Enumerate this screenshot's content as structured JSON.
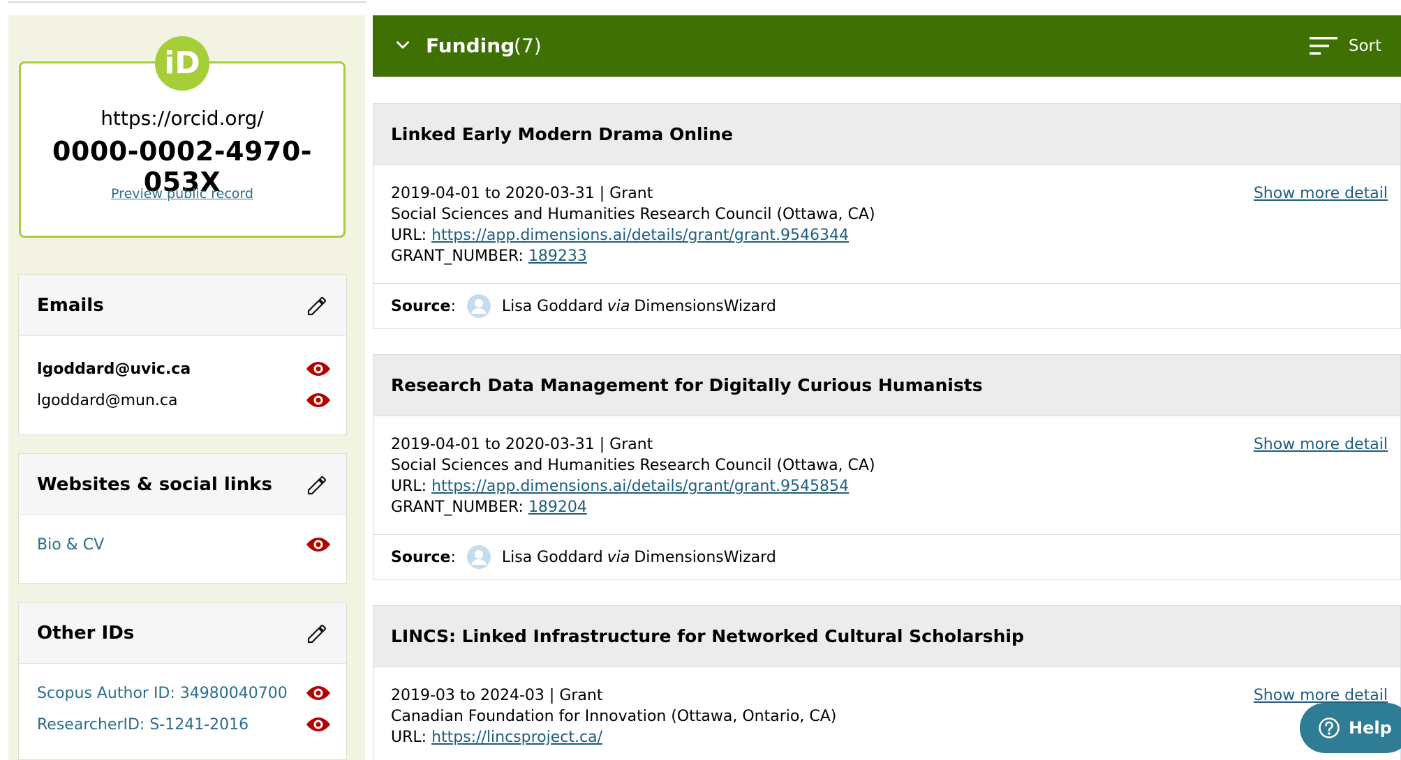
{
  "orcid": {
    "prefix": "https://orcid.org/",
    "id": "0000-0002-4970-053X",
    "preview_link": "Preview public record",
    "logo_text": "iD"
  },
  "emails": {
    "title": "Emails",
    "items": [
      "lgoddard@uvic.ca",
      "lgoddard@mun.ca"
    ]
  },
  "websites": {
    "title": "Websites & social links",
    "items": [
      "Bio & CV"
    ]
  },
  "other_ids": {
    "title": "Other IDs",
    "items": [
      "Scopus Author ID: 34980040700",
      "ResearcherID: S-1241-2016"
    ]
  },
  "funding": {
    "title": "Funding",
    "count": "(7)",
    "sort_label": "Sort"
  },
  "labels": {
    "url": "URL: ",
    "grant_number": "GRANT_NUMBER: ",
    "source": "Source",
    "source_sep": ":",
    "via": "via",
    "show_more": "Show more detail"
  },
  "items": [
    {
      "title": "Linked Early Modern Drama Online",
      "dates": "2019-04-01 to 2020-03-31 | Grant",
      "org": "Social Sciences and Humanities Research Council (Ottawa, CA)",
      "url": "https://app.dimensions.ai/details/grant/grant.9546344",
      "grant_number": "189233",
      "source_name": "Lisa Goddard",
      "source_via": "DimensionsWizard"
    },
    {
      "title": "Research Data Management for Digitally Curious Humanists",
      "dates": "2019-04-01 to 2020-03-31 | Grant",
      "org": "Social Sciences and Humanities Research Council (Ottawa, CA)",
      "url": "https://app.dimensions.ai/details/grant/grant.9545854",
      "grant_number": "189204",
      "source_name": "Lisa Goddard",
      "source_via": "DimensionsWizard"
    },
    {
      "title": "LINCS: Linked Infrastructure for Networked Cultural Scholarship",
      "dates": "2019-03 to 2024-03 | Grant",
      "org": "Canadian Foundation for Innovation (Ottawa, Ontario, CA)",
      "url": "https://lincsproject.ca/"
    }
  ],
  "help": {
    "label": "Help"
  },
  "colors": {
    "orcid_green": "#a6ce39",
    "funding_header": "#3e7003",
    "link": "#1e5f80",
    "eye": "#b50000",
    "help": "#2e7d95"
  }
}
